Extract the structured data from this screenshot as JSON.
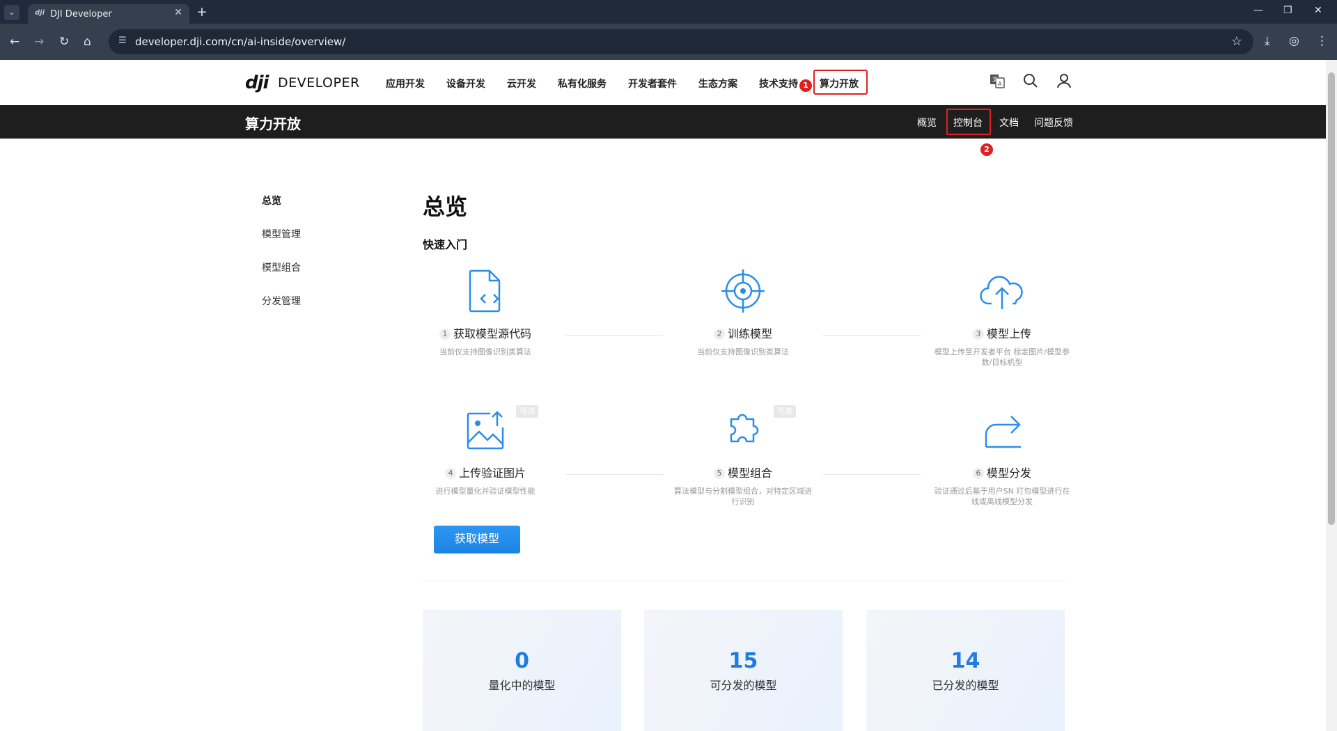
{
  "browser": {
    "tab_title": "DJI Developer",
    "tab_favicon": "dji",
    "tab_close": "✕",
    "new_tab": "+",
    "url": "developer.dji.com/cn/ai-inside/overview/"
  },
  "header": {
    "logo_mark": "dji",
    "logo_word": "DEVELOPER",
    "nav": [
      "应用开发",
      "设备开发",
      "云开发",
      "私有化服务",
      "开发者套件",
      "生态方案",
      "技术支持",
      "算力开放"
    ],
    "marker_1": "1"
  },
  "subheader": {
    "title": "算力开放",
    "nav": [
      "概览",
      "控制台",
      "文档",
      "问题反馈"
    ],
    "marker_2": "2"
  },
  "sidebar": {
    "items": [
      "总览",
      "模型管理",
      "模型组合",
      "分发管理"
    ]
  },
  "main": {
    "title": "总览",
    "section": "快速入门",
    "optional_badge": "可选",
    "steps": [
      {
        "num": "1",
        "label": "获取模型源代码",
        "desc": "当前仅支持图像识别类算法"
      },
      {
        "num": "2",
        "label": "训练模型",
        "desc": "当前仅支持图像识别类算法"
      },
      {
        "num": "3",
        "label": "模型上传",
        "desc": "模型上传至开发者平台 标定图片/模型参数/目标机型"
      },
      {
        "num": "4",
        "label": "上传验证图片",
        "desc": "进行模型量化并验证模型性能"
      },
      {
        "num": "5",
        "label": "模型组合",
        "desc": "算法模型与分割模型组合，对特定区域进行识别"
      },
      {
        "num": "6",
        "label": "模型分发",
        "desc": "验证通过后基于用户SN 打包模型进行在线或离线模型分发"
      }
    ],
    "button": "获取模型",
    "stats": [
      {
        "value": "0",
        "label": "量化中的模型"
      },
      {
        "value": "15",
        "label": "可分发的模型"
      },
      {
        "value": "14",
        "label": "已分发的模型"
      }
    ]
  },
  "colors": {
    "accent": "#1a84e6",
    "highlight_red": "#e02020",
    "subheader_bg": "#1e1e1e"
  }
}
